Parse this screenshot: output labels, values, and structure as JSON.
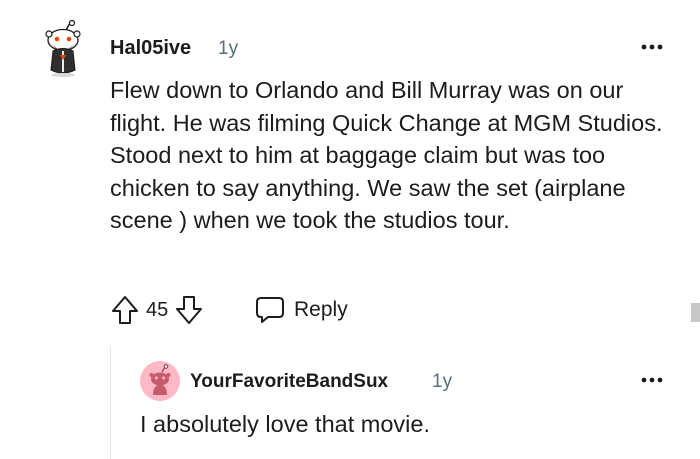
{
  "comment": {
    "username": "Hal05ive",
    "age": "1y",
    "body": "Flew down to Orlando and Bill Murray was on our flight. He was filming Quick Change at MGM Studios. Stood next to him at baggage claim but was too chicken to say anything. We saw the set (airplane scene ) when we took the studios tour.",
    "score": "45",
    "reply_label": "Reply",
    "more_icon": "more-options-icon",
    "upvote_icon": "upvote-arrow-icon",
    "downvote_icon": "downvote-arrow-icon",
    "reply_icon": "speech-bubble-icon"
  },
  "reply": {
    "username": "YourFavoriteBandSux",
    "age": "1y",
    "body": "I absolutely love that movie.",
    "more_icon": "more-options-icon"
  },
  "colors": {
    "text": "#1c1c1c",
    "meta": "#576f76",
    "icon": "#576f76",
    "reply_avatar_bg": "#ffb8c6",
    "thread_line": "#e5e5e5"
  }
}
